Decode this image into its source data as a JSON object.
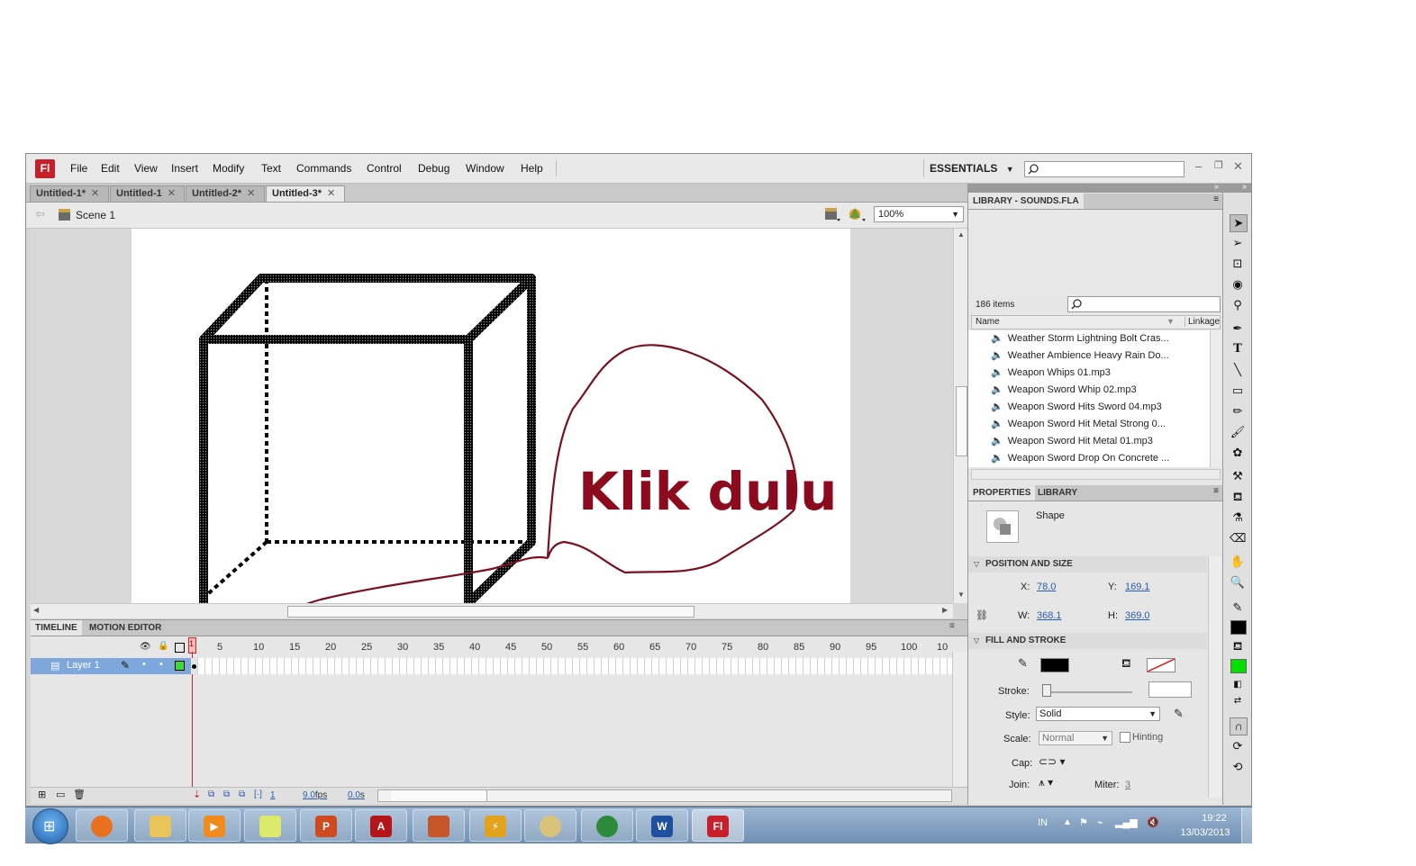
{
  "app": {
    "logo": "Fl"
  },
  "menu": [
    "File",
    "Edit",
    "View",
    "Insert",
    "Modify",
    "Text",
    "Commands",
    "Control",
    "Debug",
    "Window",
    "Help"
  ],
  "workspace": {
    "label": "ESSENTIALS"
  },
  "doc_tabs": [
    {
      "label": "Untitled-1*"
    },
    {
      "label": "Untitled-1"
    },
    {
      "label": "Untitled-2*"
    },
    {
      "label": "Untitled-3*"
    }
  ],
  "editbar": {
    "scene": "Scene 1",
    "zoom": "100%"
  },
  "annotation": {
    "text": "Klik dulu",
    "color": "#8b0a1e"
  },
  "timeline": {
    "tabs": [
      "TIMELINE",
      "MOTION EDITOR"
    ],
    "frame_numbers": [
      "5",
      "10",
      "15",
      "20",
      "25",
      "30",
      "35",
      "40",
      "45",
      "50",
      "55",
      "60",
      "65",
      "70",
      "75",
      "80",
      "85",
      "90",
      "95",
      "100",
      "10"
    ],
    "current_frame_marker": "1",
    "layer_name": "Layer 1",
    "status_frame": "1",
    "fps": "9.0",
    "fps_unit": "fps",
    "time": "0.0",
    "time_unit": "s"
  },
  "library": {
    "tab": "LIBRARY - SOUNDS.FLA",
    "count": "186 items",
    "col_name": "Name",
    "col_linkage": "Linkage",
    "items": [
      "Weather Storm Lightning Bolt Cras...",
      "Weather Ambience Heavy Rain Do...",
      "Weapon Whips 01.mp3",
      "Weapon Sword Whip 02.mp3",
      "Weapon Sword Hits Sword 04.mp3",
      "Weapon Sword Hit Metal Strong 0...",
      "Weapon Sword Hit Metal 01.mp3",
      "Weapon Sword Drop On Concrete ..."
    ]
  },
  "properties": {
    "tabs": [
      "PROPERTIES",
      "LIBRARY"
    ],
    "type": "Shape",
    "position_size_title": "POSITION AND SIZE",
    "x_label": "X:",
    "x": "78.0",
    "y_label": "Y:",
    "y": "169.1",
    "w_label": "W:",
    "w": "368.1",
    "h_label": "H:",
    "h": "369.0",
    "fill_stroke_title": "FILL AND STROKE",
    "stroke_label": "Stroke:",
    "style_label": "Style:",
    "style": "Solid",
    "scale_label": "Scale:",
    "scale": "Normal",
    "hinting": "Hinting",
    "cap_label": "Cap:",
    "join_label": "Join:",
    "miter_label": "Miter:",
    "miter": "3",
    "stroke_color": "#000000",
    "fill_color": "none"
  },
  "tools": {
    "fill_swatch": "#00e000",
    "stroke_swatch": "#000000"
  },
  "taskbar": {
    "lang": "IN",
    "time": "19:22",
    "date": "13/03/2013"
  }
}
